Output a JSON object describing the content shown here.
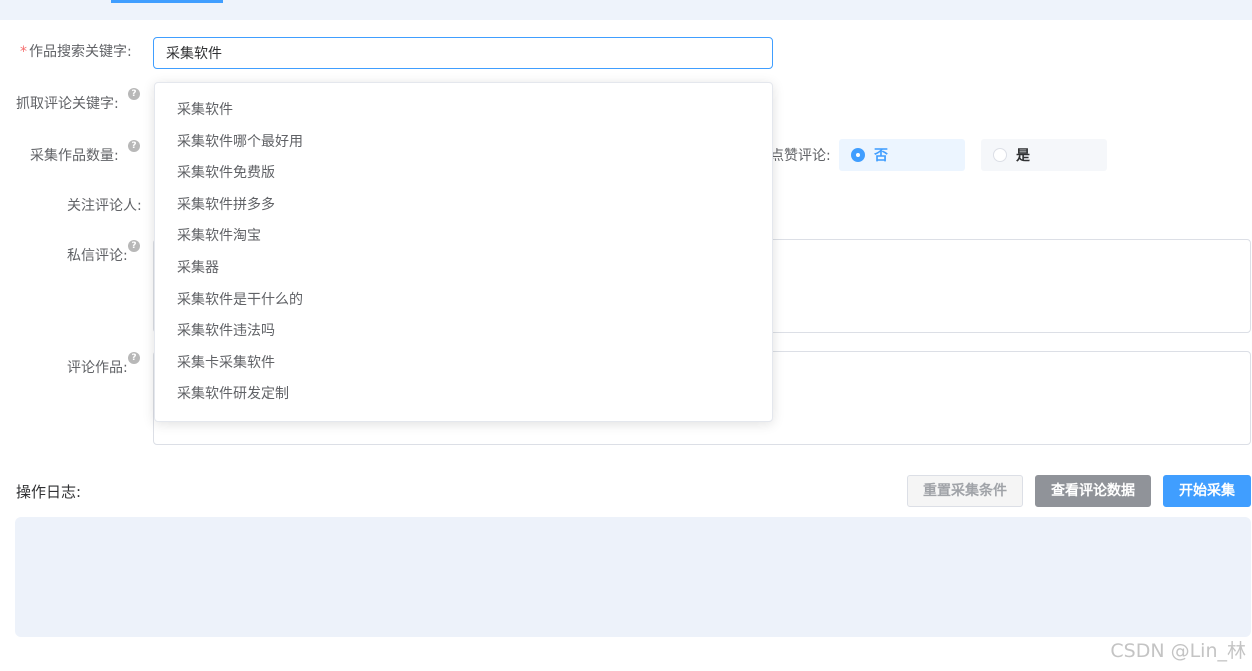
{
  "form": {
    "keyword_label": "作品搜索关键字:",
    "keyword_required_mark": "*",
    "keyword_value": "采集软件",
    "comment_keyword_label": "抓取评论关键字:",
    "count_label": "采集作品数量:",
    "like_label": "点赞评论:",
    "follow_label": "关注评论人:",
    "dm_label": "私信评论:",
    "comment_work_label": "评论作品:",
    "help_glyph": "?"
  },
  "like_radio": {
    "options": [
      "否",
      "是"
    ],
    "selected": "否"
  },
  "suggestions": [
    "采集软件",
    "采集软件哪个最好用",
    "采集软件免费版",
    "采集软件拼多多",
    "采集软件淘宝",
    "采集器",
    "采集软件是干什么的",
    "采集软件违法吗",
    "采集卡采集软件",
    "采集软件研发定制"
  ],
  "actions": {
    "reset": "重置采集条件",
    "view": "查看评论数据",
    "start": "开始采集"
  },
  "log": {
    "title": "操作日志:"
  },
  "watermark": "CSDN @Lin_林",
  "colors": {
    "primary": "#409eff",
    "required": "#f56c6c",
    "log_bg": "#edf2fa"
  }
}
